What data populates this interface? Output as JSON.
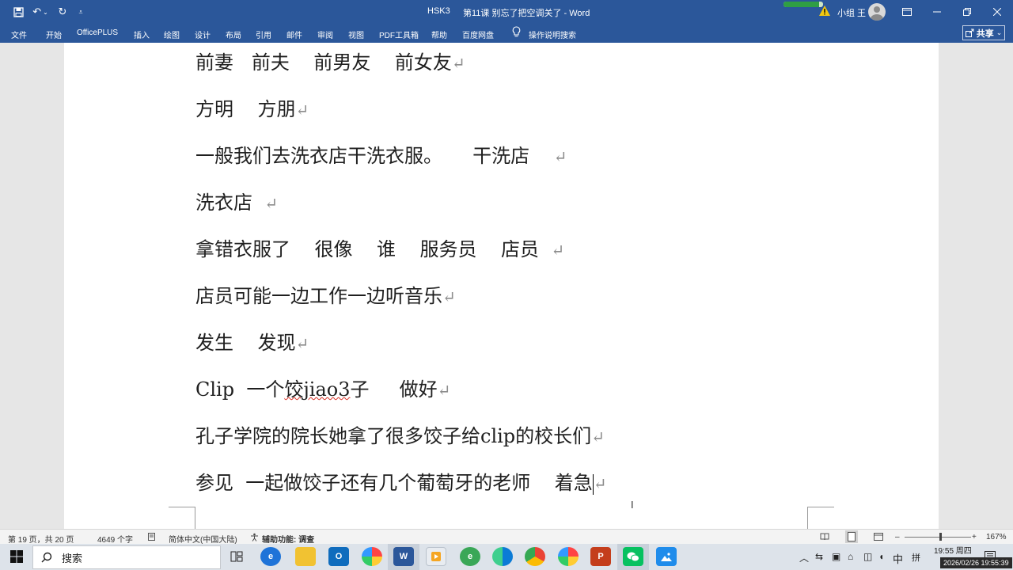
{
  "titlebar": {
    "doc_short": "HSK3",
    "title": "第11课 别忘了把空调关了  -  Word",
    "user": "小组 王",
    "sync_progress": 0.9
  },
  "quick_access": {
    "save": "save-icon",
    "undo": "undo-icon",
    "redo": "redo-icon",
    "customize": "customize-icon"
  },
  "ribbon": {
    "tabs": [
      "文件",
      "开始",
      "OfficePLUS",
      "插入",
      "绘图",
      "设计",
      "布局",
      "引用",
      "邮件",
      "审阅",
      "视图",
      "PDF工具箱",
      "帮助",
      "百度网盘"
    ],
    "tellme": "操作说明搜索",
    "share": "共享"
  },
  "document": {
    "lines": [
      "前妻   前夫    前男友    前女友",
      "方明    方朋",
      "一般我们去洗衣店干洗衣服。     干洗店    ",
      "洗衣店  ",
      "拿错衣服了    很像    谁    服务员    店员  ",
      "店员可能一边工作一边听音乐",
      "发生    发现",
      "Clip  一个",
      "孔子学院的院长她拿了很多饺子给clip的校长们",
      "参见  一起做饺子还有几个葡萄牙的老师    着急"
    ],
    "clip_misspelled": "饺jiao3",
    "clip_rest": "子     做好"
  },
  "status": {
    "page": "第 19 页，共 20 页",
    "words": "4649 个字",
    "language": "简体中文(中国大陆)",
    "accessibility": "辅助功能: 调查",
    "zoom": "167%"
  },
  "taskbar": {
    "search_placeholder": "搜索",
    "ime": "中",
    "ime2": "拼",
    "time": "19:55 周四",
    "date": "2026/02/26 19:55:39"
  }
}
